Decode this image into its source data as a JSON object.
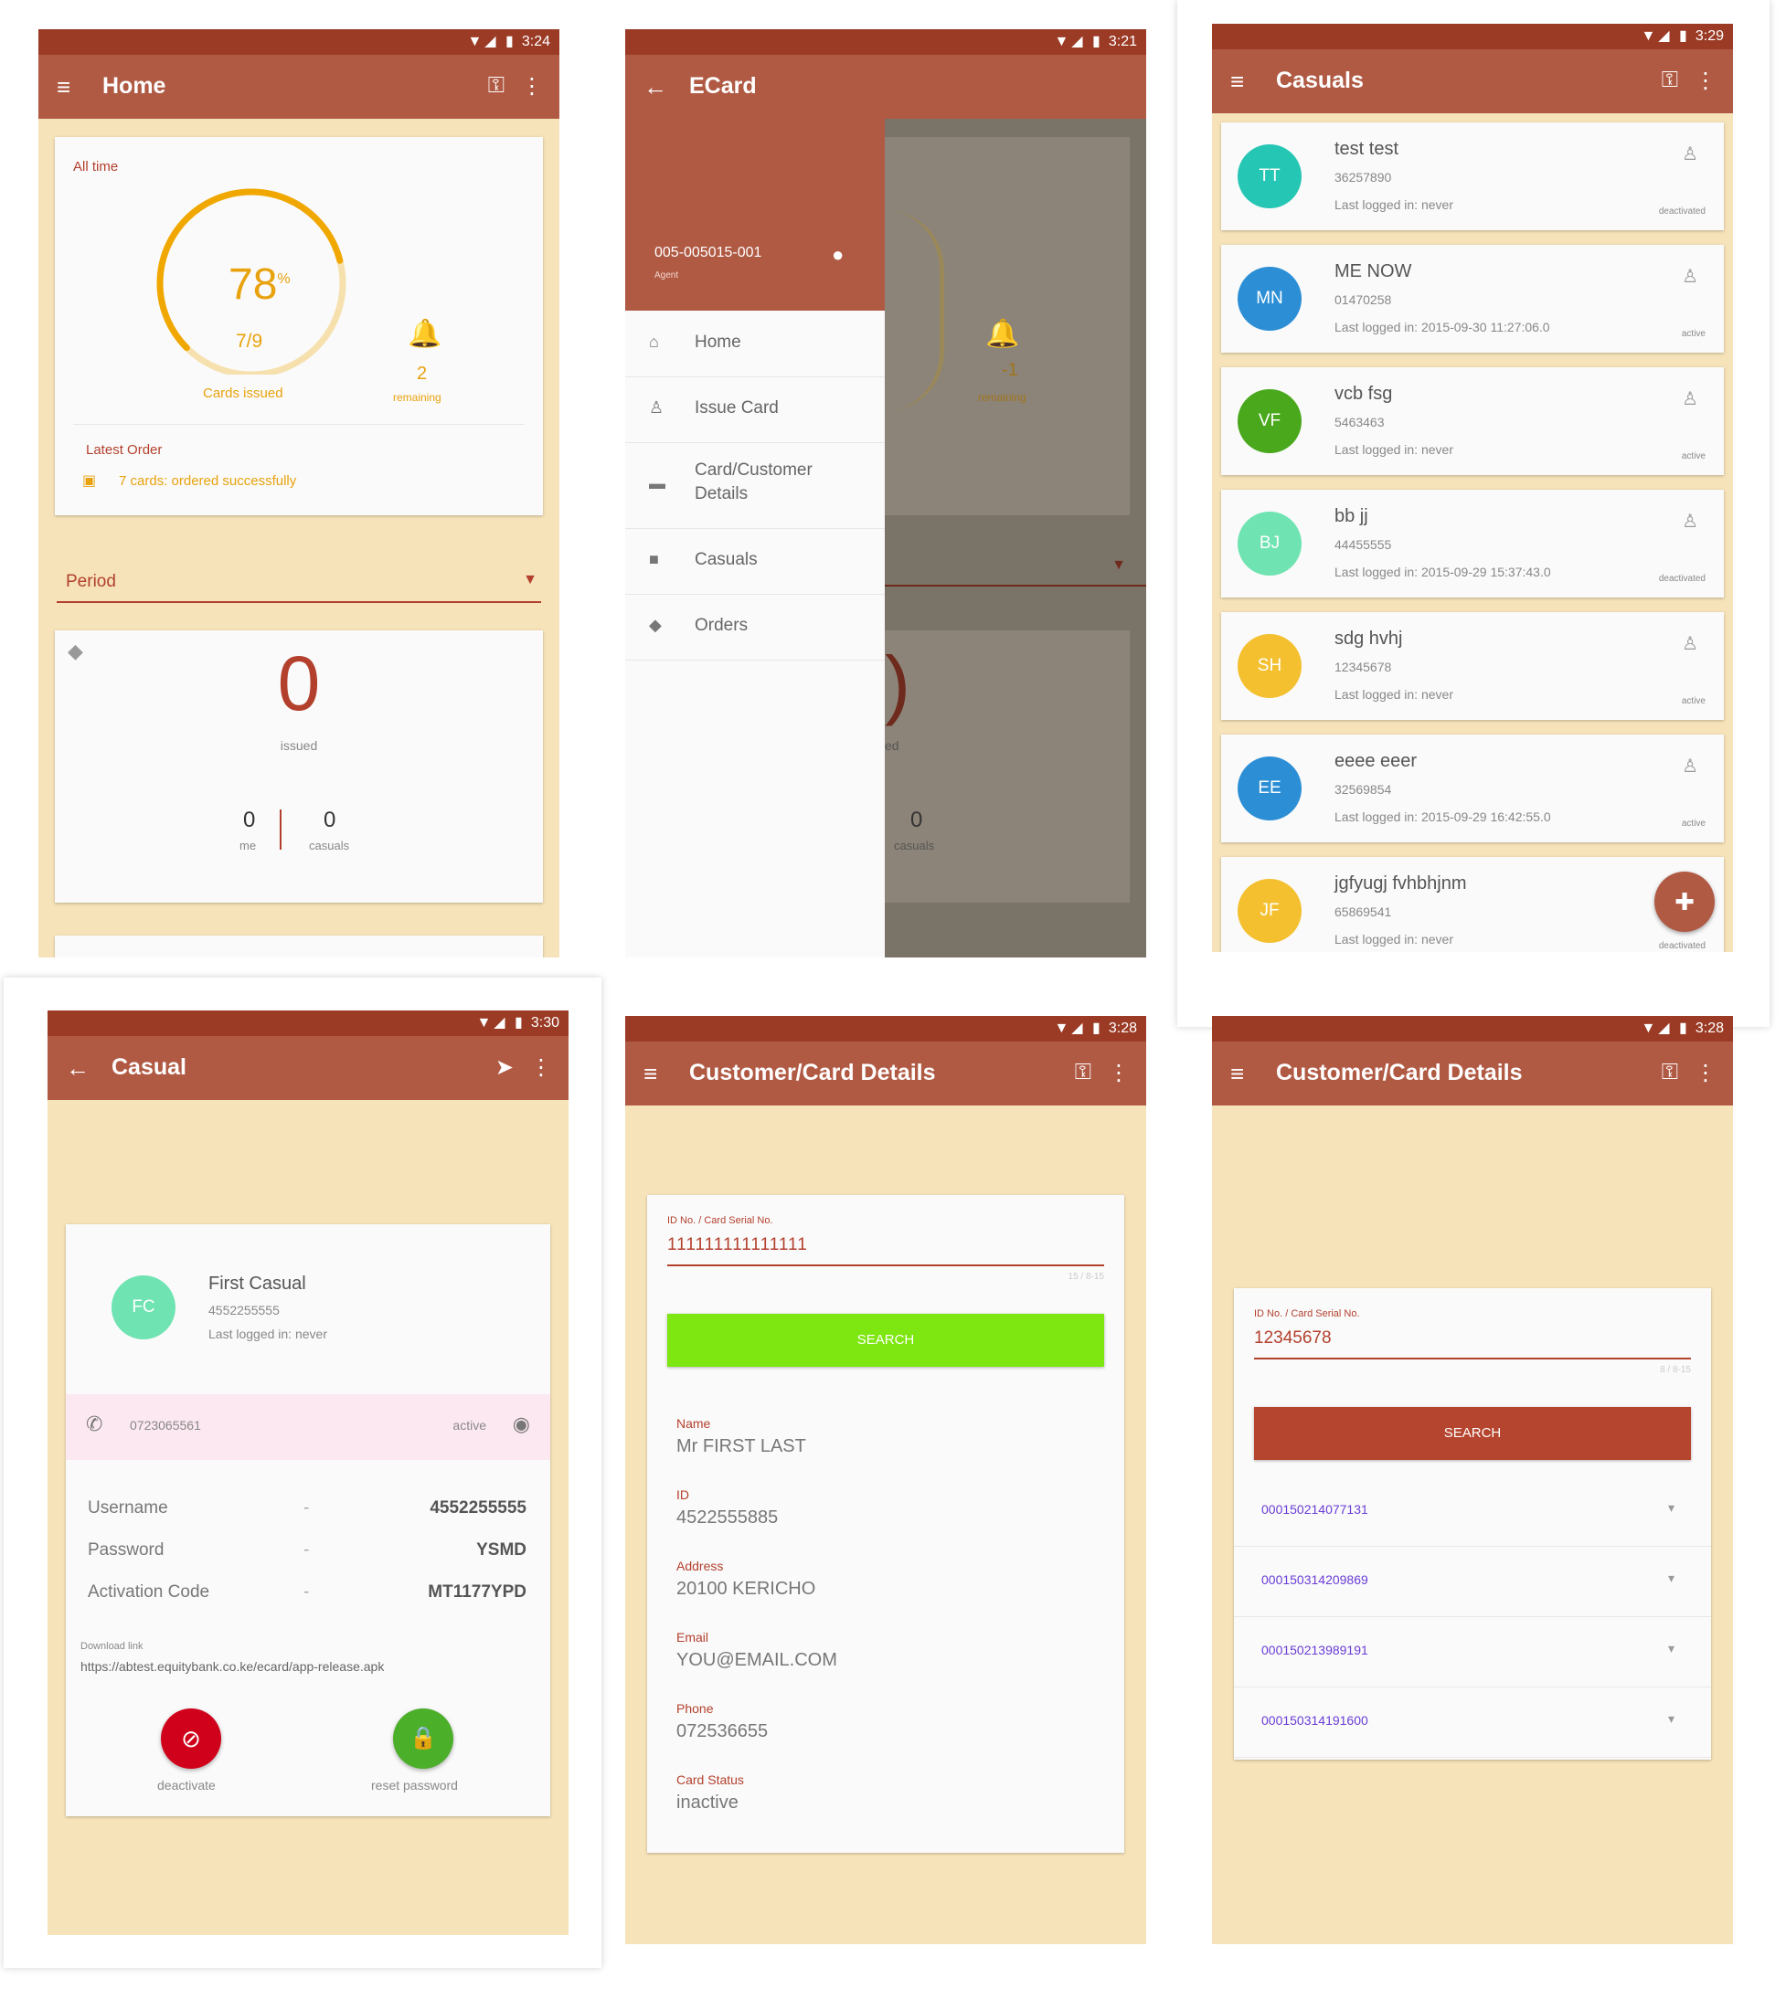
{
  "status": {
    "time_home": "3:24",
    "time_ecard": "3:21",
    "time_casuals": "3:29",
    "time_casual": "3:30",
    "time_details1": "3:28",
    "time_details2": "3:28",
    "icons": "▼◢ ▮"
  },
  "home": {
    "title": "Home",
    "all_time": "All time",
    "percent": "78",
    "percent_sign": "%",
    "fraction": "7/9",
    "cards_issued": "Cards issued",
    "remaining_count": "2",
    "remaining_label": "remaining",
    "latest_order": "Latest Order",
    "order_text": "7 cards: ordered successfully",
    "period": "Period",
    "issued_count": "0",
    "issued_label": "issued",
    "me_count": "0",
    "me_label": "me",
    "casuals_count": "0",
    "casuals_label": "casuals",
    "gauge_progress": 0.78
  },
  "ecard": {
    "title": "ECard",
    "agent_id": "005-005015-001",
    "agent_role": "Agent",
    "menu": [
      {
        "label": "Home",
        "icon": "home-icon",
        "glyph": "⌂"
      },
      {
        "label": "Issue Card",
        "icon": "person-icon",
        "glyph": "♙"
      },
      {
        "label": "Card/Customer\nDetails",
        "icon": "card-icon",
        "glyph": "▬"
      },
      {
        "label": "Casuals",
        "icon": "briefcase-icon",
        "glyph": "■"
      },
      {
        "label": "Orders",
        "icon": "tag-icon",
        "glyph": "◆"
      }
    ],
    "behind_remaining": "-1",
    "behind_remaining_label": "remaining",
    "behind_issued_label": "ed",
    "behind_count": "0",
    "behind_casuals": "casuals",
    "behind_big": ")"
  },
  "casuals": {
    "title": "Casuals",
    "items": [
      {
        "initials": "TT",
        "color": "#26c6b4",
        "name": "test test",
        "number": "36257890",
        "last": "Last logged in: never",
        "status": "deactivated"
      },
      {
        "initials": "MN",
        "color": "#2c8fd6",
        "name": "ME NOW",
        "number": "01470258",
        "last": "Last logged in: 2015-09-30 11:27:06.0",
        "status": "active"
      },
      {
        "initials": "VF",
        "color": "#49a81c",
        "name": "vcb fsg",
        "number": "5463463",
        "last": "Last logged in: never",
        "status": "active"
      },
      {
        "initials": "BJ",
        "color": "#6fe3b2",
        "name": "bb jj",
        "number": "44455555",
        "last": "Last logged in: 2015-09-29 15:37:43.0",
        "status": "deactivated"
      },
      {
        "initials": "SH",
        "color": "#f4c02f",
        "name": "sdg hvhj",
        "number": "12345678",
        "last": "Last logged in: never",
        "status": "active"
      },
      {
        "initials": "EE",
        "color": "#2c8fd6",
        "name": "eeee eeer",
        "number": "32569854",
        "last": "Last logged in: 2015-09-29 16:42:55.0",
        "status": "active"
      },
      {
        "initials": "JF",
        "color": "#f4c02f",
        "name": "jgfyugj fvhbhjnm",
        "number": "65869541",
        "last": "Last logged in: never",
        "status": "deactivated"
      }
    ]
  },
  "casual": {
    "title": "Casual",
    "initials": "FC",
    "name": "First Casual",
    "number": "4552255555",
    "last": "Last logged in: never",
    "phone": "0723065561",
    "status": "active",
    "fields": [
      {
        "label": "Username",
        "value": "4552255555"
      },
      {
        "label": "Password",
        "value": "YSMD"
      },
      {
        "label": "Activation Code",
        "value": "MT1177YPD"
      }
    ],
    "dash": "-",
    "download_label": "Download link",
    "download_url": "https://abtest.equitybank.co.ke/ecard/app-release.apk",
    "deactivate": "deactivate",
    "reset_password": "reset password"
  },
  "details1": {
    "title": "Customer/Card Details",
    "field_label": "ID No. / Card Serial No.",
    "field_value": "111111111111111",
    "counter": "15 / 8-15",
    "search": "SEARCH",
    "info": [
      {
        "label": "Name",
        "value": "Mr FIRST LAST"
      },
      {
        "label": "ID",
        "value": "4522555885"
      },
      {
        "label": "Address",
        "value": "20100 KERICHO"
      },
      {
        "label": "Email",
        "value": "YOU@EMAIL.COM"
      },
      {
        "label": "Phone",
        "value": "072536655"
      },
      {
        "label": "Card Status",
        "value": "inactive"
      }
    ]
  },
  "details2": {
    "title": "Customer/Card Details",
    "field_label": "ID No. / Card Serial No.",
    "field_value": "12345678",
    "counter": "8 / 8-15",
    "search": "SEARCH",
    "cards": [
      "000150214077131",
      "000150314209869",
      "000150213989191",
      "000150314191600"
    ]
  },
  "colors": {
    "primary": "#b05a44",
    "primary_dark": "#9b3b26",
    "background": "#f6e3b9",
    "accent_gold": "#f0a800",
    "search_green": "#7ee610"
  }
}
